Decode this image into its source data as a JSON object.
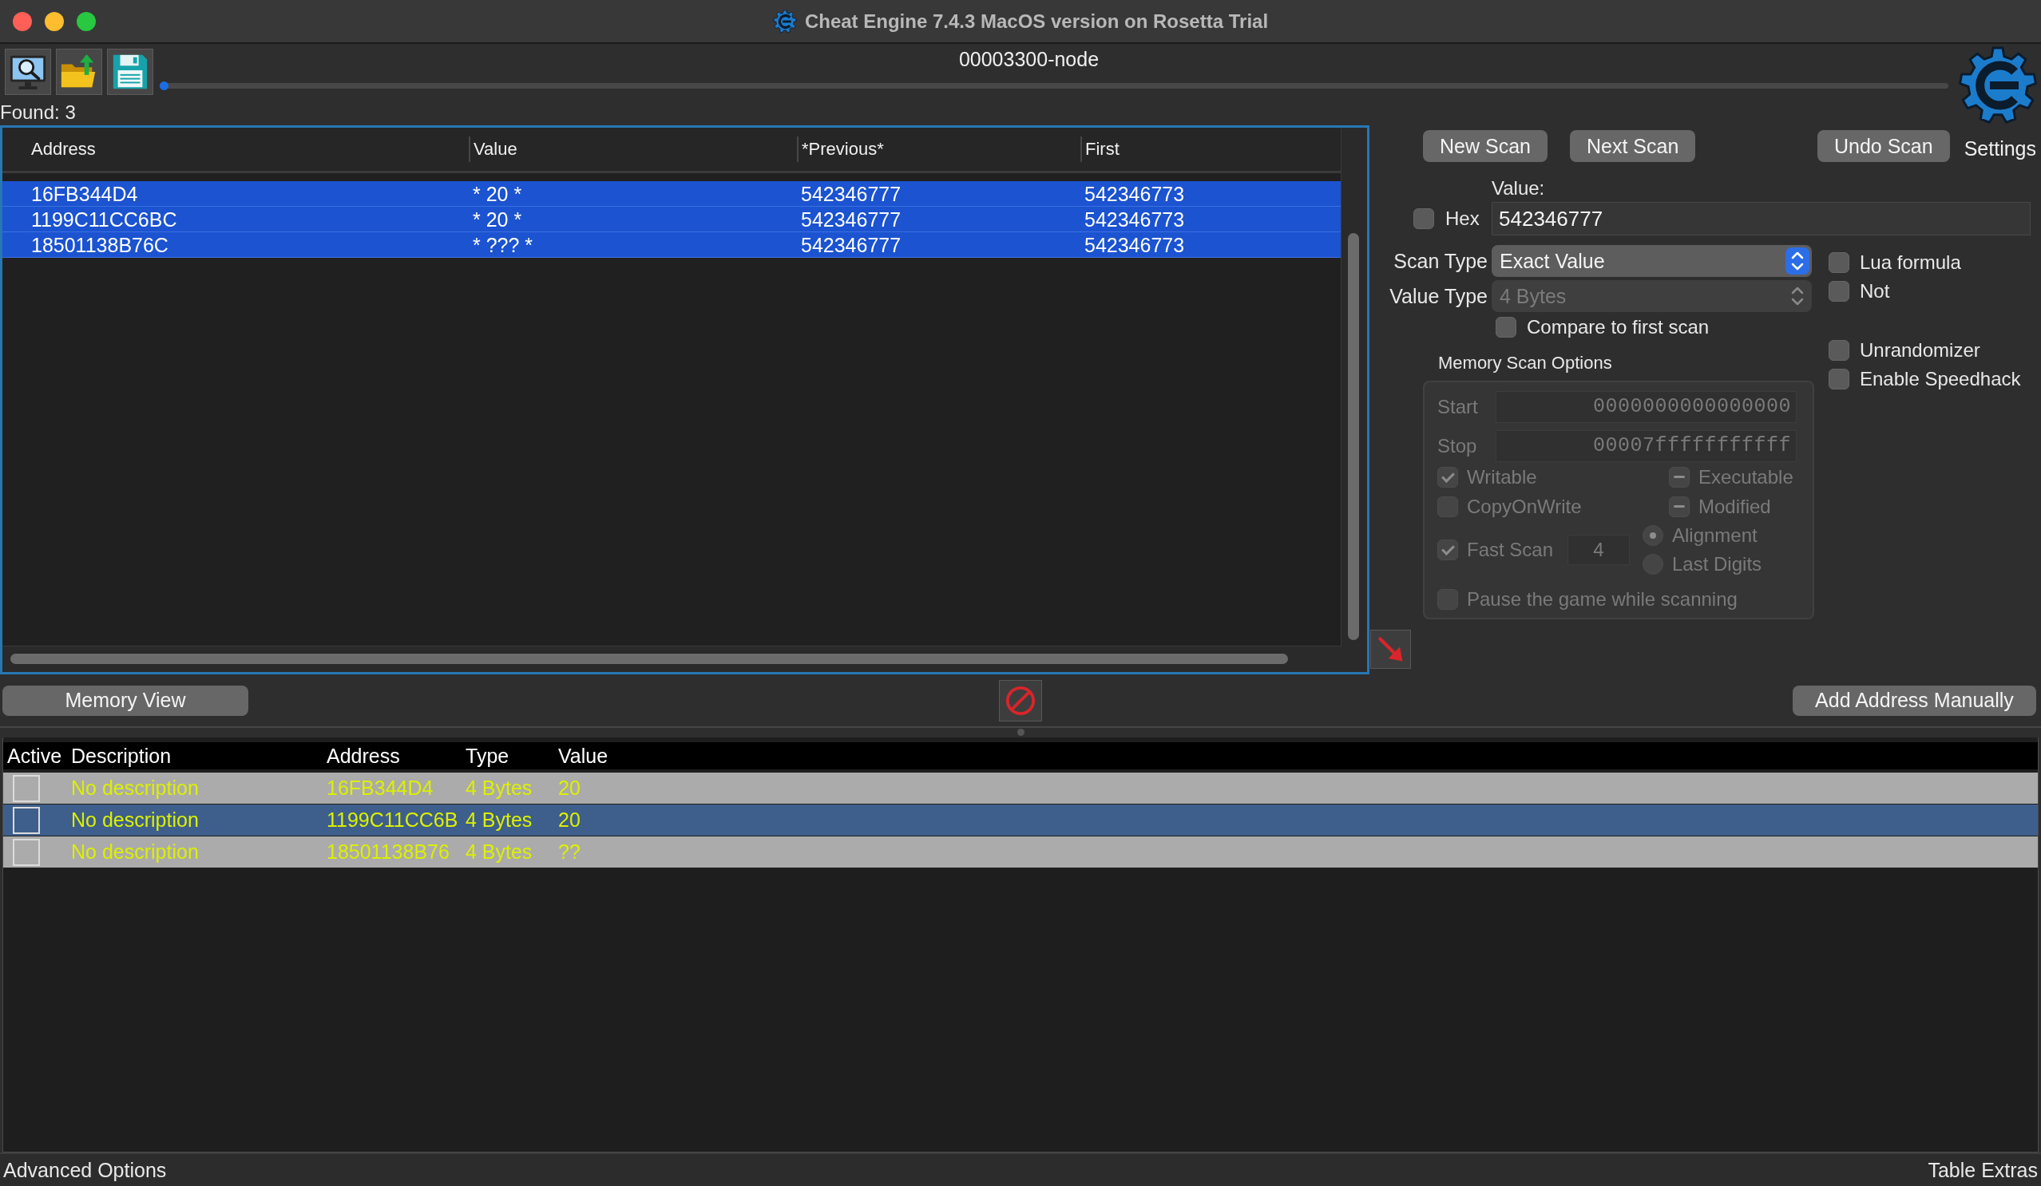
{
  "window": {
    "title": "Cheat Engine 7.4.3 MacOS version on Rosetta Trial"
  },
  "process": {
    "name": "00003300-node"
  },
  "progress_bar": {
    "level": 0.005
  },
  "found_label": "Found: 3",
  "settings_label": "Settings",
  "scan_results": {
    "columns": [
      "Address",
      "Value",
      "*Previous*",
      "First"
    ],
    "rows": [
      {
        "address": "16FB344D4",
        "value": "* 20 *",
        "previous": "542346777",
        "first": "542346773",
        "selected": true
      },
      {
        "address": "1199C11CC6BC",
        "value": "* 20 *",
        "previous": "542346777",
        "first": "542346773",
        "selected": true
      },
      {
        "address": "18501138B76C",
        "value": "* ??? *",
        "previous": "542346777",
        "first": "542346773",
        "selected": true
      }
    ]
  },
  "scan_buttons": [
    "New Scan",
    "Next Scan",
    "Undo Scan"
  ],
  "value": {
    "label": "Value:",
    "hex": {
      "label": "Hex",
      "checked": false
    },
    "input": "542346777"
  },
  "scan_type": {
    "label": "Scan Type",
    "value": "Exact Value",
    "disabled": false
  },
  "value_type": {
    "label": "Value Type",
    "value": "4 Bytes",
    "disabled": true
  },
  "compare_to_first_scan": {
    "label": "Compare to first scan",
    "checked": false
  },
  "memory_scan_options": {
    "title": "Memory Scan Options",
    "disabled": true,
    "start": {
      "label": "Start",
      "value": "0000000000000000"
    },
    "stop": {
      "label": "Stop",
      "value": "00007fffffffffff"
    },
    "flags": [
      {
        "label": "Writable",
        "checked": true,
        "mixed": false
      },
      {
        "label": "Executable",
        "checked": false,
        "mixed": true
      },
      {
        "label": "CopyOnWrite",
        "checked": false,
        "mixed": false
      },
      {
        "label": "Modified",
        "checked": false,
        "mixed": true
      }
    ],
    "fast_scan": {
      "label": "Fast Scan",
      "checked": true,
      "value": "4"
    },
    "alignment_modes": [
      {
        "label": "Alignment",
        "selected": true
      },
      {
        "label": "Last Digits",
        "selected": false
      }
    ],
    "pause": {
      "label": "Pause the game while scanning",
      "checked": false
    }
  },
  "options": [
    {
      "label": "Lua formula",
      "checked": false
    },
    {
      "label": "Not",
      "checked": false
    },
    {
      "label": "Unrandomizer",
      "checked": false
    },
    {
      "label": "Enable Speedhack",
      "checked": false
    }
  ],
  "memory_view_button": "Memory View",
  "add_address_button": "Add Address Manually",
  "address_list": {
    "columns": [
      "Active",
      "Description",
      "Address",
      "Type",
      "Value"
    ],
    "rows": [
      {
        "active": false,
        "description": "No description",
        "address": "16FB344D4",
        "type": "4 Bytes",
        "value": "20",
        "selected": false
      },
      {
        "active": false,
        "description": "No description",
        "address": "1199C11CC6B",
        "type": "4 Bytes",
        "value": "20",
        "selected": true
      },
      {
        "active": false,
        "description": "No description",
        "address": "18501138B76",
        "type": "4 Bytes",
        "value": "??",
        "selected": false
      }
    ]
  },
  "status_bar": {
    "left": "Advanced Options",
    "right": "Table Extras"
  }
}
